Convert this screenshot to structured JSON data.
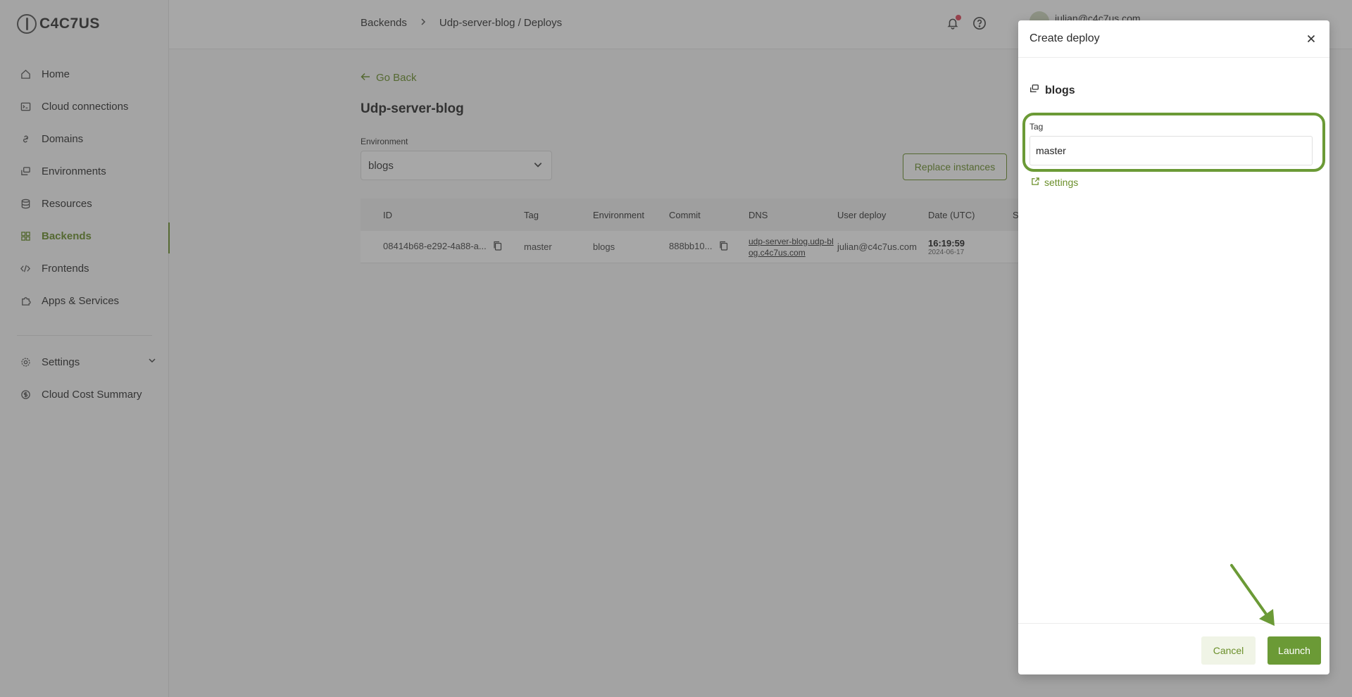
{
  "brand": {
    "name": "C4C7US"
  },
  "sidebar": {
    "items": [
      {
        "label": "Home",
        "icon": "home-icon"
      },
      {
        "label": "Cloud connections",
        "icon": "terminal-icon"
      },
      {
        "label": "Domains",
        "icon": "link-icon"
      },
      {
        "label": "Environments",
        "icon": "layers-icon"
      },
      {
        "label": "Resources",
        "icon": "database-icon"
      },
      {
        "label": "Backends",
        "icon": "grid-icon",
        "active": true
      },
      {
        "label": "Frontends",
        "icon": "code-icon"
      },
      {
        "label": "Apps & Services",
        "icon": "puzzle-icon"
      }
    ],
    "bottom_items": [
      {
        "label": "Settings",
        "icon": "gear-icon"
      },
      {
        "label": "Cloud Cost Summary",
        "icon": "dollar-icon"
      }
    ]
  },
  "header": {
    "breadcrumb": [
      "Backends",
      "Udp-server-blog / Deploys"
    ],
    "user_email": "julian@c4c7us.com"
  },
  "main": {
    "go_back": "Go Back",
    "title": "Udp-server-blog",
    "environment_label": "Environment",
    "environment_value": "blogs",
    "replace_button": "Replace instances",
    "table": {
      "columns": [
        "ID",
        "Tag",
        "Environment",
        "Commit",
        "DNS",
        "User deploy",
        "Date (UTC)",
        "S"
      ],
      "rows": [
        {
          "id": "08414b68-e292-4a88-a...",
          "tag": "master",
          "environment": "blogs",
          "commit": "888bb10...",
          "dns": "udp-server-blog.udp-blog.c4c7us.com",
          "user": "julian@c4c7us.com",
          "time": "16:19:59",
          "date": "2024-06-17"
        }
      ]
    }
  },
  "drawer": {
    "title": "Create deploy",
    "environment": "blogs",
    "tag_label": "Tag",
    "tag_value": "master",
    "settings_link": "settings",
    "cancel": "Cancel",
    "launch": "Launch"
  },
  "colors": {
    "accent": "#6b8f2a",
    "highlight": "#6b9a36",
    "status": "#2e8f7c",
    "notification": "#e0455a"
  }
}
